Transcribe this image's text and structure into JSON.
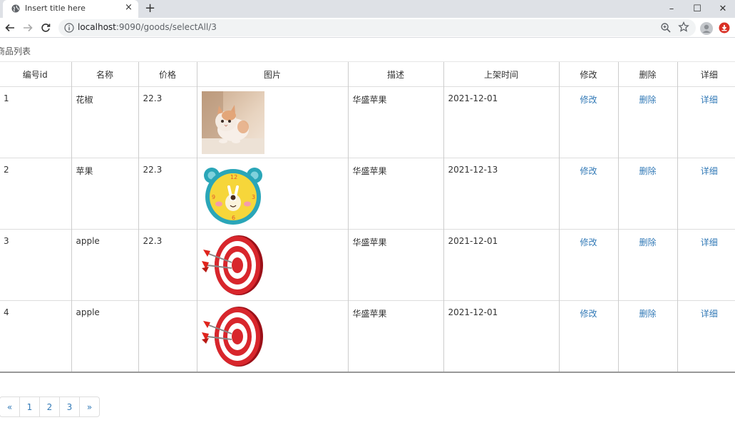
{
  "browser": {
    "tab_title": "Insert title here",
    "tab_close": "×",
    "new_tab": "+",
    "url_host": "localhost",
    "url_path": ":9090/goods/selectAll/3",
    "minimize": "–",
    "maximize": "☐",
    "close": "✕"
  },
  "page": {
    "title": "商品列表"
  },
  "table": {
    "headers": [
      "编号id",
      "名称",
      "价格",
      "图片",
      "描述",
      "上架时间",
      "修改",
      "删除",
      "详细"
    ],
    "rows": [
      {
        "id": "1",
        "name": "花椒",
        "price": "22.3",
        "image": "kitten-photo",
        "desc": "华盛苹果",
        "date": "2021-12-01",
        "edit": "修改",
        "delete": "删除",
        "detail": "详细"
      },
      {
        "id": "2",
        "name": "苹果",
        "price": "22.3",
        "image": "bear-clock",
        "desc": "华盛苹果",
        "date": "2021-12-13",
        "edit": "修改",
        "delete": "删除",
        "detail": "详细"
      },
      {
        "id": "3",
        "name": "apple",
        "price": "22.3",
        "image": "dart-target",
        "desc": "华盛苹果",
        "date": "2021-12-01",
        "edit": "修改",
        "delete": "删除",
        "detail": "详细"
      },
      {
        "id": "4",
        "name": "apple",
        "price": "",
        "image": "dart-target",
        "desc": "华盛苹果",
        "date": "2021-12-01",
        "edit": "修改",
        "delete": "删除",
        "detail": "详细"
      }
    ]
  },
  "pagination": {
    "prev": "«",
    "pages": [
      "1",
      "2",
      "3"
    ],
    "next": "»"
  },
  "colors": {
    "link": "#337ab7",
    "tab_bar": "#dee1e6"
  }
}
